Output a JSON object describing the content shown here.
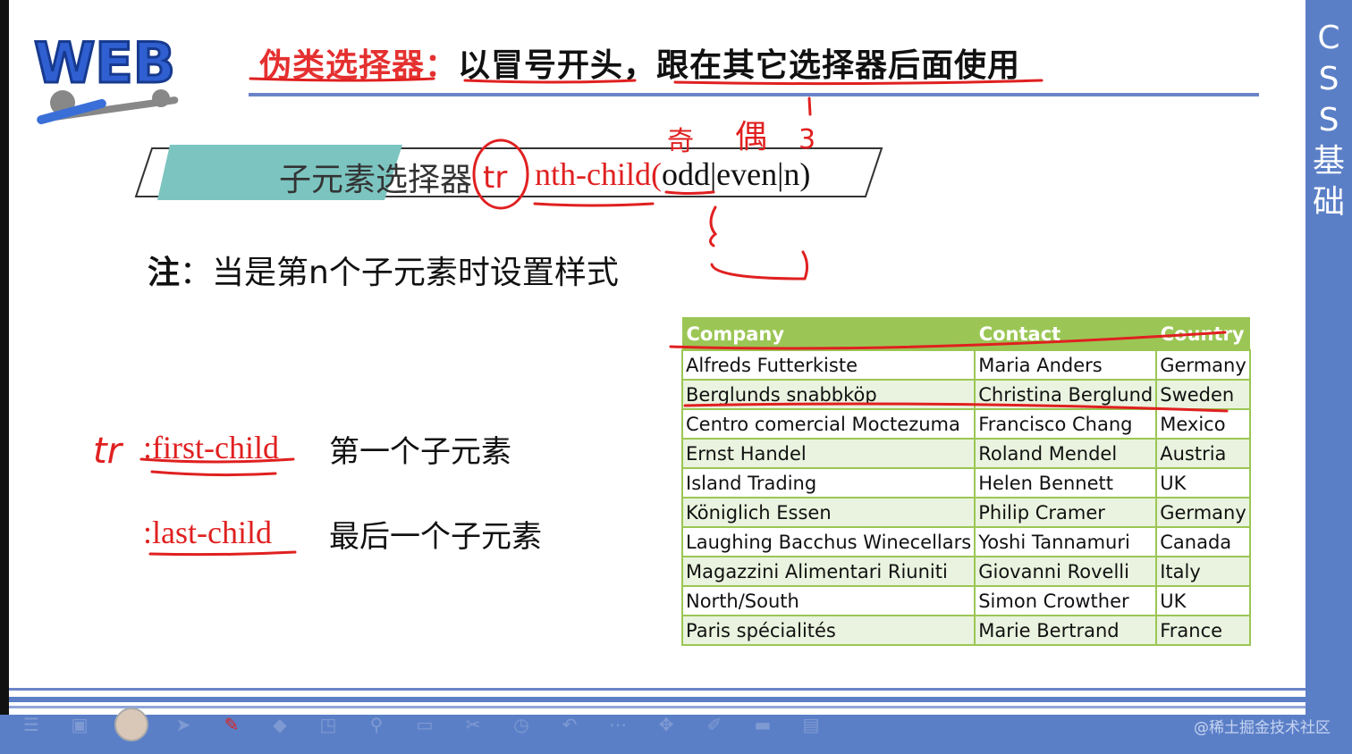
{
  "sidebar_title": "CSS基础",
  "logo_text": "WEB",
  "title": {
    "highlight": "伪类选择器：",
    "rest": "以冒号开头，跟在其它选择器后面使用"
  },
  "subtitle": {
    "label": "子元素选择器",
    "code_prefix": ":",
    "code_name": "nth-child(",
    "code_args": "odd|even|n)"
  },
  "note": {
    "bold": "注",
    "text": "：当是第n个子元素时设置样式"
  },
  "selectors": [
    {
      "name": ":first-child",
      "desc": "第一个子元素"
    },
    {
      "name": ":last-child",
      "desc": "最后一个子元素"
    }
  ],
  "handwriting": {
    "tr_circle": "tr",
    "odd_note": "奇",
    "even_note": "偶",
    "num_1": "1",
    "num_3": "3",
    "tr_first": "tr"
  },
  "table": {
    "headers": [
      "Company",
      "Contact",
      "Country"
    ],
    "rows": [
      [
        "Alfreds Futterkiste",
        "Maria Anders",
        "Germany"
      ],
      [
        "Berglunds snabbköp",
        "Christina Berglund",
        "Sweden"
      ],
      [
        "Centro comercial Moctezuma",
        "Francisco Chang",
        "Mexico"
      ],
      [
        "Ernst Handel",
        "Roland Mendel",
        "Austria"
      ],
      [
        "Island Trading",
        "Helen Bennett",
        "UK"
      ],
      [
        "Königlich Essen",
        "Philip Cramer",
        "Germany"
      ],
      [
        "Laughing Bacchus Winecellars",
        "Yoshi Tannamuri",
        "Canada"
      ],
      [
        "Magazzini Alimentari Riuniti",
        "Giovanni Rovelli",
        "Italy"
      ],
      [
        "North/South",
        "Simon Crowther",
        "UK"
      ],
      [
        "Paris spécialités",
        "Marie Bertrand",
        "France"
      ]
    ]
  },
  "toolbar_icons": [
    "menu-icon",
    "screen-icon",
    "avatar",
    "pointer-icon",
    "pen-icon",
    "eraser-icon",
    "shape-icon",
    "zoom-icon",
    "window-icon",
    "scissors-icon",
    "clock-icon",
    "undo-icon",
    "more-icon",
    "move-icon",
    "edit-icon",
    "monitor-icon",
    "document-icon"
  ],
  "watermark": "@稀土掘金技术社区",
  "colors": {
    "accent_blue": "#5b7fc7",
    "table_green": "#9bc655",
    "annotation_red": "#e02020"
  }
}
